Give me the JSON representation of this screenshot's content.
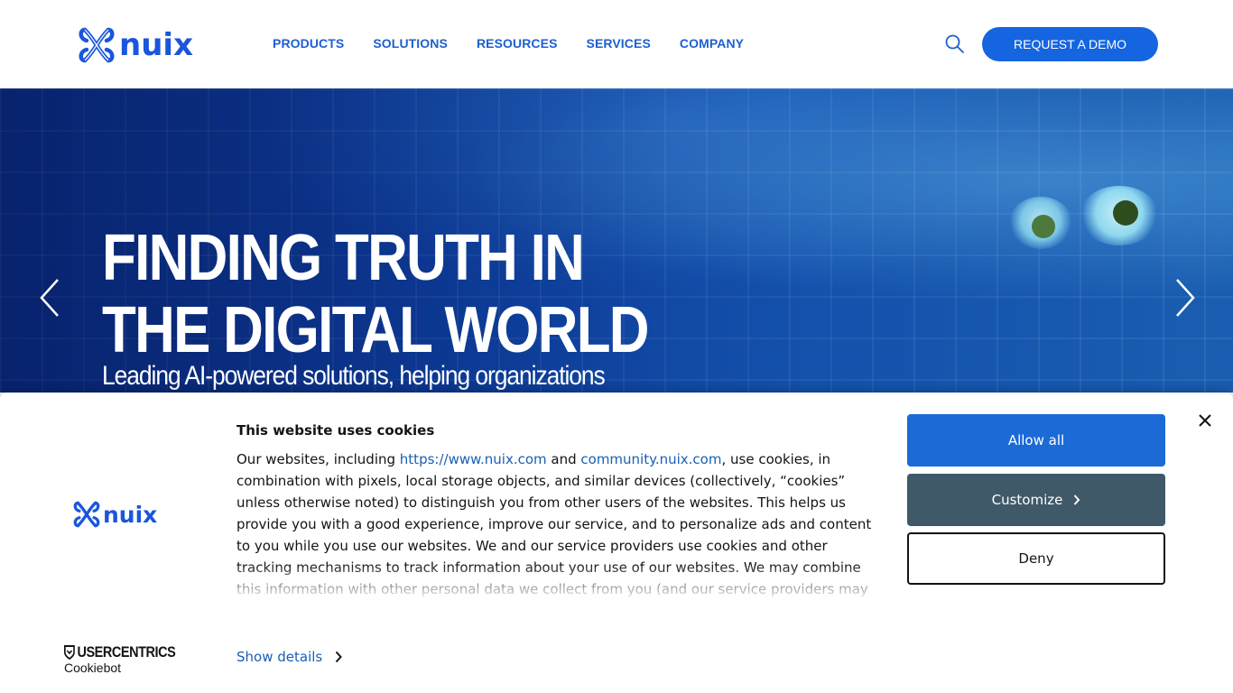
{
  "header": {
    "logo_text": "nuix",
    "nav": [
      "PRODUCTS",
      "SOLUTIONS",
      "RESOURCES",
      "SERVICES",
      "COMPANY"
    ],
    "demo_label": "REQUEST A DEMO"
  },
  "hero": {
    "title_line1": "FINDING TRUTH IN",
    "title_line2": "THE DIGITAL WORLD",
    "subtitle": "Leading AI-powered solutions, helping organizations"
  },
  "cookie": {
    "logo_text": "nuix",
    "title": "This website uses cookies",
    "body_prefix": "Our websites, including ",
    "link1": "https://www.nuix.com",
    "body_and": " and ",
    "link2": "community.nuix.com",
    "body_rest": ", use cookies, in combination with pixels, local storage objects, and similar devices (collectively, “cookies” unless otherwise noted) to distinguish you from other users of the websites. This helps us provide you with a good experience, improve our service, and to personalize ads and content to you while you use our websites. We and our service providers use cookies and other tracking mechanisms to track information about your use of our websites. We may combine this information with other personal data we collect from you (and our service providers may do so on our behalf).",
    "show_details": "Show details",
    "allow_all": "Allow all",
    "customize": "Customize",
    "deny": "Deny",
    "brand_top": "USERCENTRICS",
    "brand_bottom": "Cookiebot"
  },
  "colors": {
    "brand_blue": "#1a56db",
    "nav_blue": "#1d5fd1",
    "allow_button": "#1b6ad6",
    "customize_button": "#3f5968"
  }
}
